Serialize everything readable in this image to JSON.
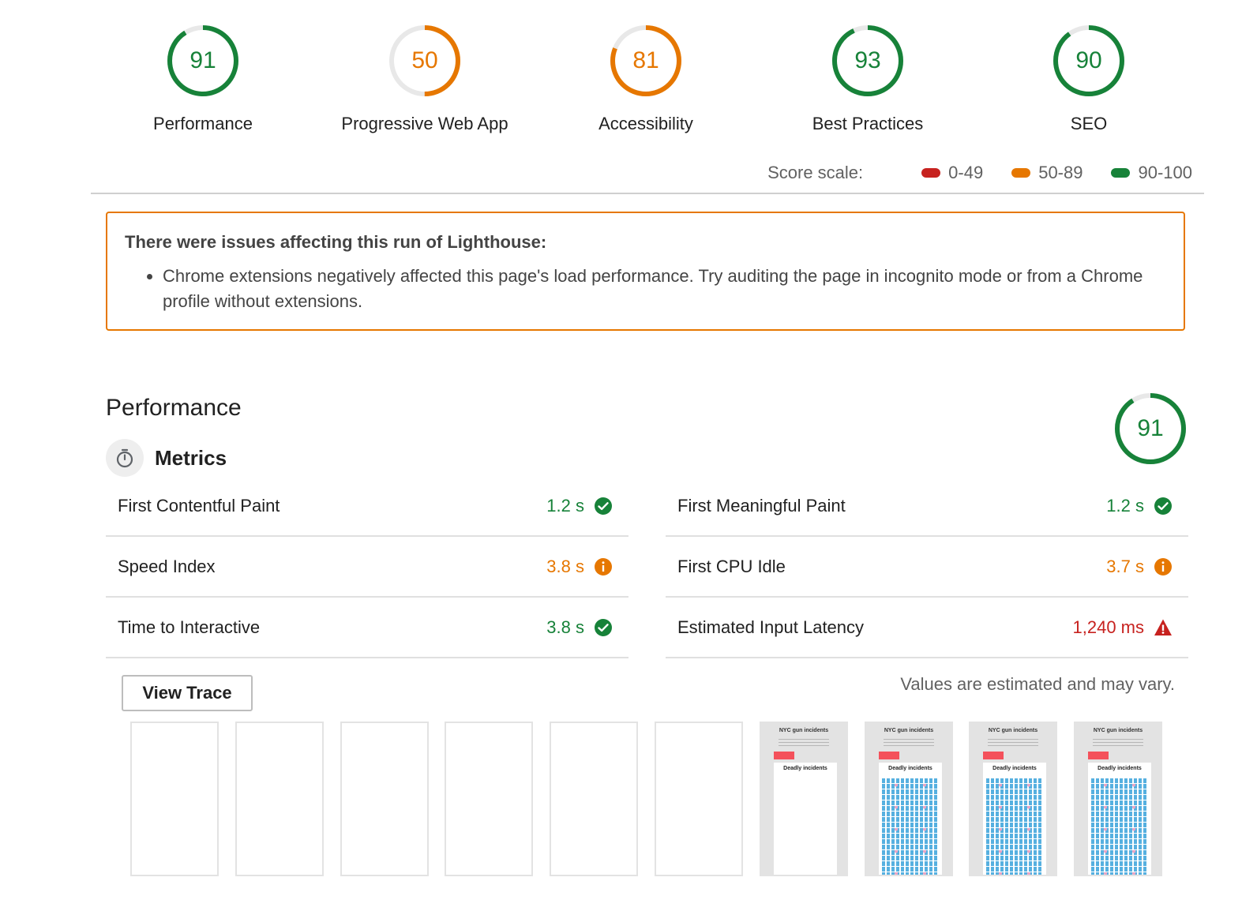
{
  "colors": {
    "pass": "#178239",
    "average": "#e67700",
    "fail": "#c7221f",
    "track": "#e8e8e8"
  },
  "gauges": [
    {
      "score": "91",
      "label": "Performance",
      "rating": "pass"
    },
    {
      "score": "50",
      "label": "Progressive Web App",
      "rating": "average"
    },
    {
      "score": "81",
      "label": "Accessibility",
      "rating": "average"
    },
    {
      "score": "93",
      "label": "Best Practices",
      "rating": "pass"
    },
    {
      "score": "90",
      "label": "SEO",
      "rating": "pass"
    }
  ],
  "score_scale": {
    "title": "Score scale:",
    "ranges": [
      {
        "label": "0-49",
        "rating": "fail"
      },
      {
        "label": "50-89",
        "rating": "average"
      },
      {
        "label": "90-100",
        "rating": "pass"
      }
    ]
  },
  "warning": {
    "title": "There were issues affecting this run of Lighthouse:",
    "items": [
      "Chrome extensions negatively affected this page's load performance. Try auditing the page in incognito mode or from a Chrome profile without extensions."
    ]
  },
  "performance": {
    "title": "Performance",
    "score": "91",
    "metrics_title": "Metrics",
    "stopwatch_icon": "stopwatch-icon",
    "metrics": [
      {
        "name": "First Contentful Paint",
        "value": "1.2 s",
        "rating": "pass",
        "icon": "check-circle-icon"
      },
      {
        "name": "First Meaningful Paint",
        "value": "1.2 s",
        "rating": "pass",
        "icon": "check-circle-icon"
      },
      {
        "name": "Speed Index",
        "value": "3.8 s",
        "rating": "average",
        "icon": "info-circle-icon"
      },
      {
        "name": "First CPU Idle",
        "value": "3.7 s",
        "rating": "average",
        "icon": "info-circle-icon"
      },
      {
        "name": "Time to Interactive",
        "value": "3.8 s",
        "rating": "pass",
        "icon": "check-circle-icon"
      },
      {
        "name": "Estimated Input Latency",
        "value": "1,240 ms",
        "rating": "fail",
        "icon": "warning-triangle-icon"
      }
    ],
    "view_trace_label": "View Trace",
    "estimate_note": "Values are estimated and may vary."
  },
  "filmstrip": {
    "frames": [
      {
        "loaded": false
      },
      {
        "loaded": false
      },
      {
        "loaded": false
      },
      {
        "loaded": false
      },
      {
        "loaded": false
      },
      {
        "loaded": false
      },
      {
        "loaded": true,
        "title": "NYC gun incidents",
        "card_title": "Deadly incidents",
        "people": false
      },
      {
        "loaded": true,
        "title": "NYC gun incidents",
        "card_title": "Deadly incidents",
        "people": true
      },
      {
        "loaded": true,
        "title": "NYC gun incidents",
        "card_title": "Deadly incidents",
        "people": true
      },
      {
        "loaded": true,
        "title": "NYC gun incidents",
        "card_title": "Deadly incidents",
        "people": true
      }
    ]
  }
}
